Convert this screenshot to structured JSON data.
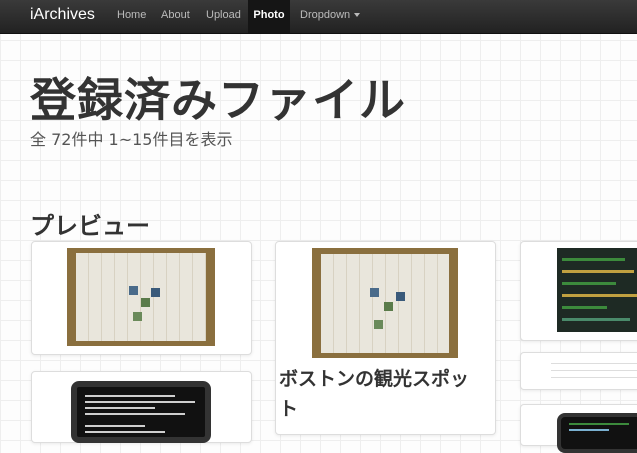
{
  "navbar": {
    "brand": "iArchives",
    "items": [
      "Home",
      "About",
      "Upload",
      "Photo",
      "Dropdown"
    ],
    "active": "Photo"
  },
  "header": {
    "title": "登録済みファイル",
    "subtitle": "全 72件中 1~15件目を表示"
  },
  "preview": {
    "heading": "プレビュー",
    "cards": [
      {
        "title": ""
      },
      {
        "title": "ボストンの観光スポット"
      }
    ]
  },
  "colors": {
    "navbar": "#222222",
    "text": "#333333",
    "accent_green": "#3c8a3c"
  }
}
